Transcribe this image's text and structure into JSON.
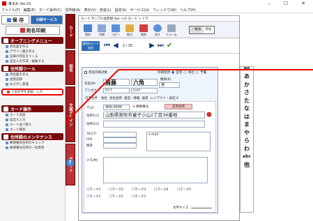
{
  "window": {
    "title": "筆まめ Ver.33",
    "minimize": "–",
    "maximize": "☐",
    "close": "✕"
  },
  "menu": [
    "ファイル(F)",
    "編集(E)",
    "カード操作(C)",
    "住所録(A)",
    "表示(V)",
    "宛名(L)",
    "設定(S)",
    "サービス(U)",
    "ウィンドウ(W)",
    "ヘルプ(H)"
  ],
  "left": {
    "save": "保 存",
    "print_service": "印刷サービス",
    "address_print": "宛名印刷",
    "opening_menu": "オープニングメニュー",
    "opening_items": [
      "宛名面を作る",
      "デザイン面を作る",
      "自筆の宛名をつくる",
      "差出人を作成・編集する"
    ],
    "address_tools": "住所録ツール",
    "tool_items": [
      "宛名面を見る",
      "送受記録",
      "おさがし管理"
    ],
    "callout_item": "人名外字を変換・入力",
    "card_ops": "カード操作",
    "card_items": [
      "カード追加",
      "差出人入力",
      "カード並べ替え",
      "カード検索"
    ],
    "maintenance": "住所録のメンテナンス",
    "maint_items": [
      "郵便番号住所のチェック",
      "郵便番号住所の一括更新"
    ]
  },
  "tabs": [
    "カード",
    "宛名",
    "文面デザイン",
    "サポート"
  ],
  "doc": {
    "title": "カード サンプル住所録.fwa  <ch カード > ドラ",
    "toolbar": [
      "保存",
      "印刷",
      "コピー",
      "貼付",
      "削除",
      "戻す",
      "フォーム",
      "一覧表",
      "宛名"
    ],
    "nav_label": "連続先カード追加",
    "nav_count": "2 / 35",
    "nav_next": "次へ",
    "nav_last": "最後",
    "nav_check": "チェック"
  },
  "card": {
    "check_label": "宛名印刷対象",
    "dest_label": "印刷住所",
    "dest_options": [
      "自宅",
      "会社",
      "予備"
    ],
    "name_label": "氏名(N)",
    "family": "斎藤",
    "given": "六角",
    "title_label": "敬称(K)",
    "title_value": "様",
    "kana_label": "フリガナ",
    "family_kana": "ｻｲﾄｳ",
    "given_kana": "ﾛｯｶｸ",
    "addr_tabs": [
      "自宅住所",
      "会社",
      "会社住所",
      "連名・情報",
      "送受",
      "レイアウト・表記 A"
    ],
    "zip_label": "〒(Z)",
    "zip": "406-0000",
    "zip_btn": "郵便番号",
    "auto_btn": "自宅住所",
    "addr1_label": "住所1(1)",
    "addr1": "山梨県笛吹市童子小山2丁目36番地",
    "addr2_label": "住所2(2)",
    "tel_label": "TEL(T)",
    "fax_label": "FAX",
    "mobile_label": "携帯",
    "email_label": "e-mail",
    "memo_label": "メモ(M)",
    "mark_labels": [
      "マーク1",
      "マーク2",
      "マーク3",
      "マーク4",
      "マーク5"
    ],
    "size_label": "文字サイズ"
  },
  "index": [
    "検索",
    "あ",
    "か",
    "さ",
    "た",
    "な",
    "は",
    "ま",
    "や",
    "ら",
    "わ",
    "abc",
    "他"
  ],
  "colors": {
    "accent": "#8a0e0e",
    "callout": "#e00000"
  }
}
